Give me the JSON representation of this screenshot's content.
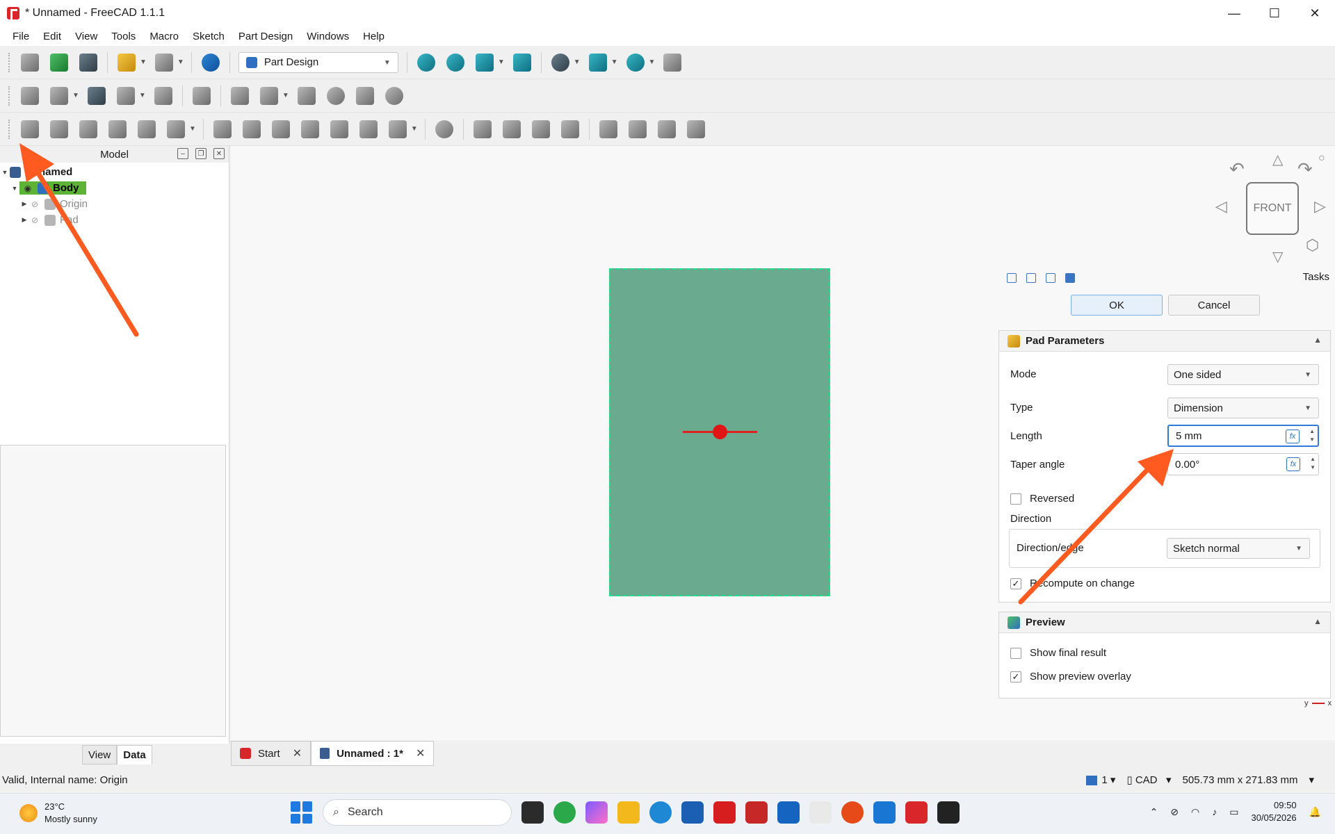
{
  "window": {
    "title": "* Unnamed - FreeCAD 1.1.1",
    "minimize": "—",
    "maximize": "☐",
    "close": "✕"
  },
  "menu": [
    "File",
    "Edit",
    "View",
    "Tools",
    "Macro",
    "Sketch",
    "Part Design",
    "Windows",
    "Help"
  ],
  "workbench": {
    "selected": "Part Design"
  },
  "model_panel": {
    "title": "Model",
    "tree": {
      "document": "Unnamed",
      "body": "Body",
      "origin": "Origin",
      "pad": "Pad"
    },
    "tabs": {
      "view": "View",
      "data": "Data"
    }
  },
  "navcube": {
    "face": "FRONT"
  },
  "tasks": {
    "label": "Tasks",
    "ok": "OK",
    "cancel": "Cancel",
    "pad_parameters": {
      "title": "Pad Parameters",
      "mode_label": "Mode",
      "mode_value": "One sided",
      "type_label": "Type",
      "type_value": "Dimension",
      "length_label": "Length",
      "length_value": "5 mm",
      "taper_label": "Taper angle",
      "taper_value": "0.00°",
      "reversed_label": "Reversed",
      "direction_label": "Direction",
      "direction_edge_label": "Direction/edge",
      "direction_edge_value": "Sketch normal",
      "recompute_label": "Recompute on change"
    },
    "preview": {
      "title": "Preview",
      "show_final": "Show final result",
      "show_overlay": "Show preview overlay"
    }
  },
  "axis": {
    "y": "y",
    "x": "x"
  },
  "doc_tabs": [
    {
      "label": "Start"
    },
    {
      "label": "Unnamed : 1*"
    }
  ],
  "status": {
    "message": "Valid, Internal name: Origin",
    "page": "1",
    "nav_style": "CAD",
    "dimensions": "505.73 mm x 271.83 mm"
  },
  "taskbar": {
    "temperature": "23°C",
    "weather": "Mostly sunny",
    "search": "Search",
    "time": "09:50",
    "date": "30/05/2026"
  },
  "colors": {
    "accent": "#2f7ad6",
    "body_highlight": "#5db335",
    "pad_face": "#6aab8f",
    "annotation_arrow": "#ff5a1f"
  }
}
